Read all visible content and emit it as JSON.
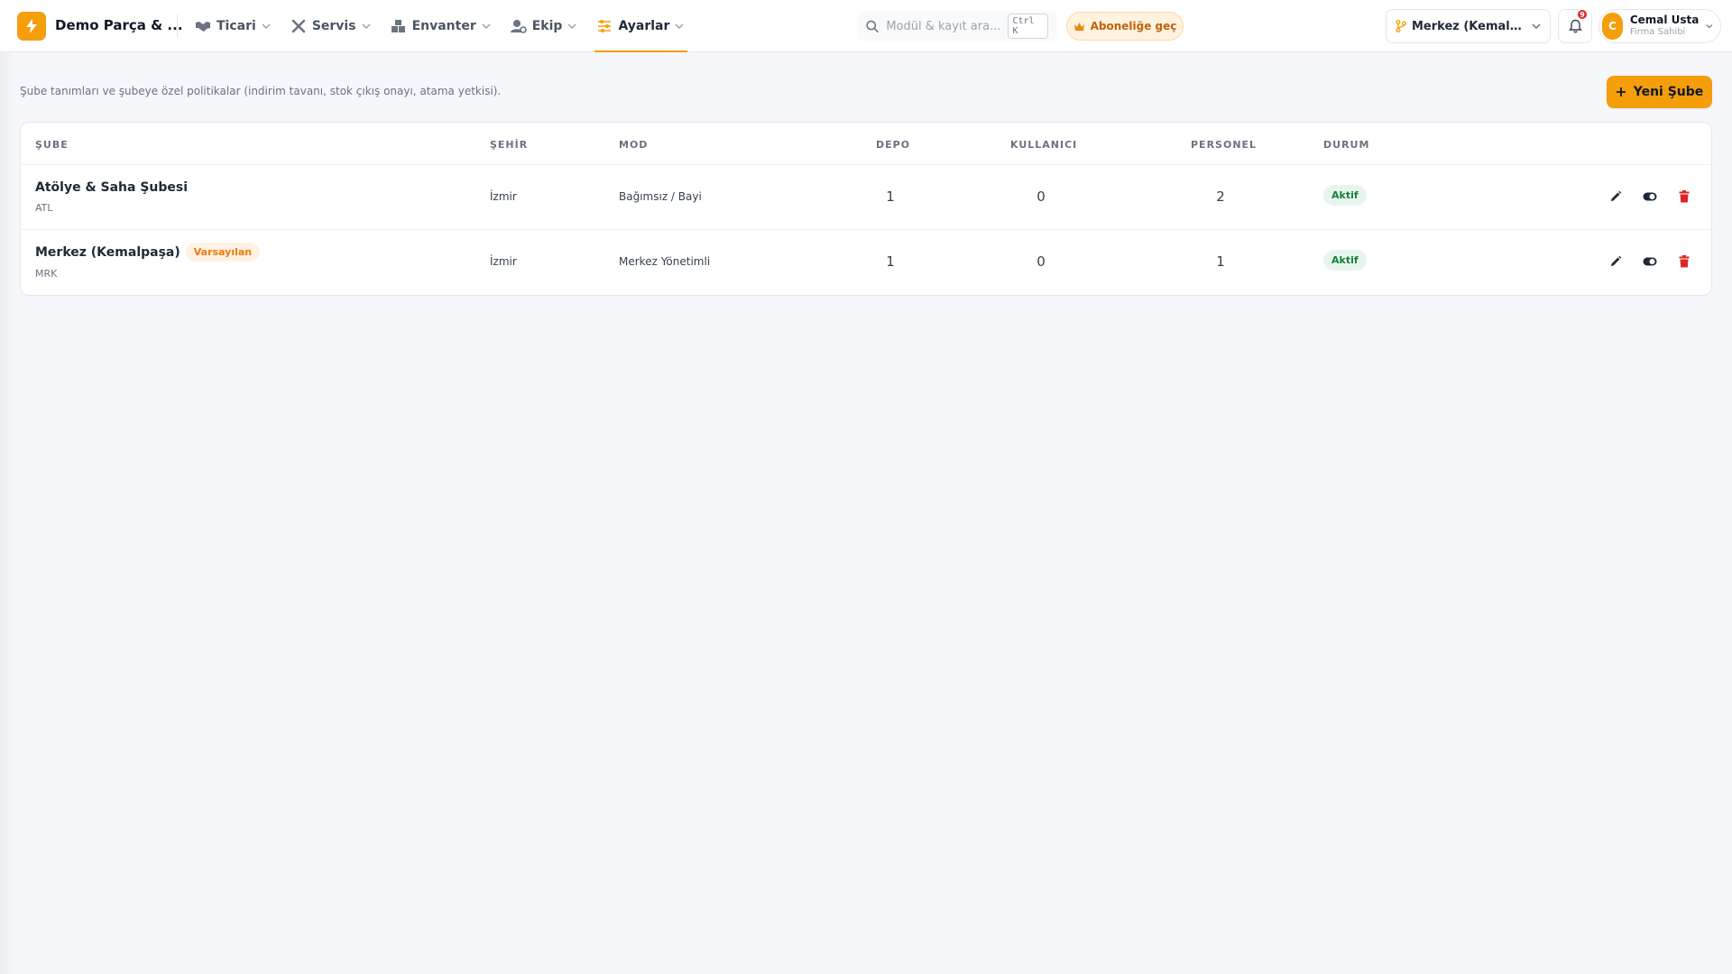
{
  "header": {
    "brand": "Demo Parça & ...",
    "nav": [
      {
        "label": "Ticari",
        "icon": "handshake-icon"
      },
      {
        "label": "Servis",
        "icon": "tools-icon"
      },
      {
        "label": "Envanter",
        "icon": "boxes-icon"
      },
      {
        "label": "Ekip",
        "icon": "users-cog-icon"
      },
      {
        "label": "Ayarlar",
        "icon": "sliders-icon",
        "active": true
      }
    ],
    "search_placeholder": "Modül & kayıt ara...",
    "search_shortcut": "Ctrl K",
    "subscribe_label": "Aboneliğe geç",
    "branch_selected": "Merkez (Kemalpa...",
    "notification_count": "9",
    "user": {
      "initial": "C",
      "name": "Cemal Usta",
      "role": "Firma Sahibi"
    }
  },
  "page": {
    "subtitle": "Şube tanımları ve şubeye özel politikalar (indirim tavanı, stok çıkış onayı, atama yetkisi).",
    "new_button_label": "Yeni Şube"
  },
  "table": {
    "columns": [
      "ŞUBE",
      "ŞEHİR",
      "MOD",
      "DEPO",
      "KULLANICI",
      "PERSONEL",
      "DURUM"
    ],
    "rows": [
      {
        "name": "Atölye & Saha Şubesi",
        "code": "ATL",
        "default_badge": "",
        "city": "İzmir",
        "mode": "Bağımsız / Bayi",
        "depot": "1",
        "users": "0",
        "staff": "2",
        "status": "Aktif"
      },
      {
        "name": "Merkez (Kemalpaşa)",
        "code": "MRK",
        "default_badge": "Varsayılan",
        "city": "İzmir",
        "mode": "Merkez Yönetimli",
        "depot": "1",
        "users": "0",
        "staff": "1",
        "status": "Aktif"
      }
    ]
  },
  "colors": {
    "accent": "#f59e0b",
    "status_active_text": "#15803d",
    "status_active_bg": "#e7f6ec",
    "delete": "#dc2626"
  }
}
